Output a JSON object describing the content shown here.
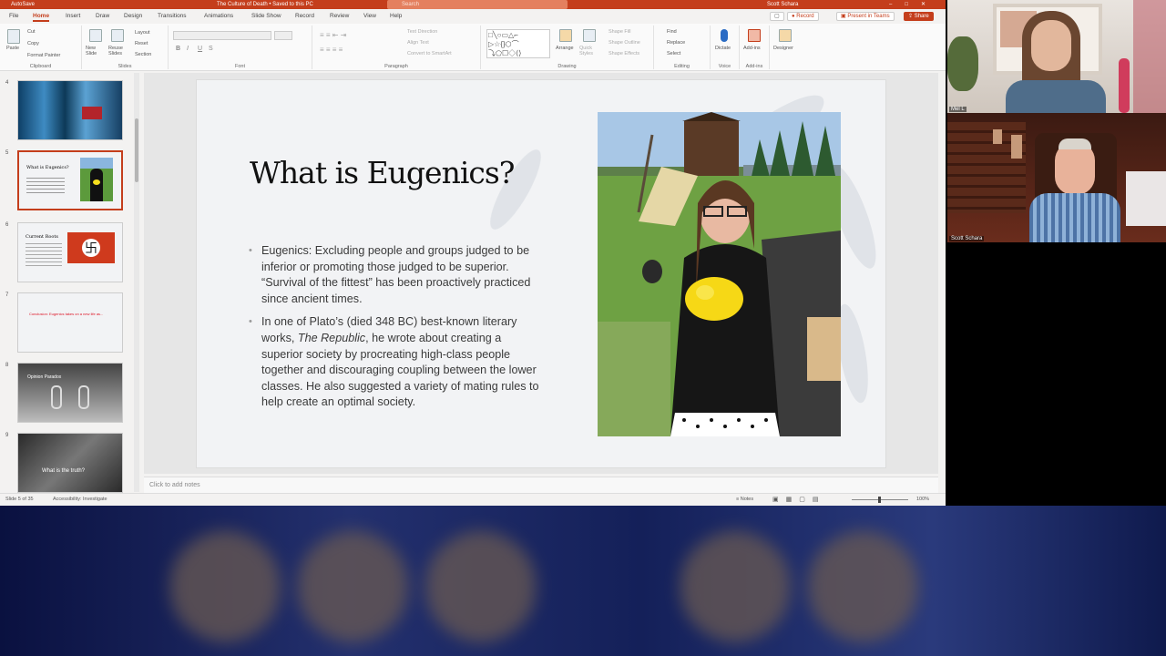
{
  "titlebar": {
    "autosave": "AutoSave",
    "doc_title": "The Culture of Death • Saved to this PC",
    "search_placeholder": "Search",
    "user": "Scott Schara"
  },
  "tabs": [
    {
      "label": "File"
    },
    {
      "label": "Home"
    },
    {
      "label": "Insert"
    },
    {
      "label": "Draw"
    },
    {
      "label": "Design"
    },
    {
      "label": "Transitions"
    },
    {
      "label": "Animations"
    },
    {
      "label": "Slide Show"
    },
    {
      "label": "Record"
    },
    {
      "label": "Review"
    },
    {
      "label": "View"
    },
    {
      "label": "Help"
    }
  ],
  "tab_buttons": {
    "record": "Record",
    "present": "Present in Teams",
    "share": "Share"
  },
  "ribbon": {
    "clipboard": {
      "paste": "Paste",
      "cut": "Cut",
      "copy": "Copy",
      "format_painter": "Format Painter",
      "label": "Clipboard"
    },
    "slides": {
      "new_slide": "New Slide",
      "reuse": "Reuse Slides",
      "layout": "Layout",
      "reset": "Reset",
      "section": "Section",
      "label": "Slides"
    },
    "font": {
      "label": "Font"
    },
    "paragraph": {
      "text_direction": "Text Direction",
      "align_text": "Align Text",
      "smartart": "Convert to SmartArt",
      "label": "Paragraph"
    },
    "drawing": {
      "arrange": "Arrange",
      "quick_styles": "Quick Styles",
      "shape_fill": "Shape Fill",
      "shape_outline": "Shape Outline",
      "shape_effects": "Shape Effects",
      "label": "Drawing"
    },
    "editing": {
      "find": "Find",
      "replace": "Replace",
      "select": "Select",
      "label": "Editing"
    },
    "voice": {
      "dictate": "Dictate",
      "label": "Voice"
    },
    "addins": {
      "addins": "Add-ins",
      "label": "Add-ins"
    },
    "designer": {
      "designer": "Designer"
    }
  },
  "thumbnails": [
    {
      "num": "4",
      "text": ""
    },
    {
      "num": "5",
      "text": "What is Eugenics?"
    },
    {
      "num": "6",
      "text": "Current Roots"
    },
    {
      "num": "7",
      "text": "Conclusion: Eugenics takes on a new life as..."
    },
    {
      "num": "8",
      "text": "Opinion Paradox"
    },
    {
      "num": "9",
      "text": "What is the truth?"
    }
  ],
  "slide": {
    "title": "What is Eugenics?",
    "bullet1": "Eugenics:  Excluding people and groups judged to be inferior or promoting those judged to be superior.  “Survival of the fittest” has been proactively practiced since ancient times.",
    "bullet2_a": "In one of Plato’s (died 348 BC) best-known literary works, ",
    "bullet2_em": "The Republic",
    "bullet2_b": ", he wrote about creating a superior society by procreating high-class people together and discouraging coupling between the lower classes. He also suggested a variety of mating rules to help create an optimal society."
  },
  "notes_placeholder": "Click to add notes",
  "status": {
    "slide_counter": "Slide 5 of 35",
    "accessibility": "Accessibility: Investigate",
    "notes": "Notes",
    "zoom": "100%"
  },
  "participants": [
    {
      "name": "Mel L"
    },
    {
      "name": "Scott Schara"
    }
  ],
  "colors": {
    "accent": "#c43e1c"
  }
}
